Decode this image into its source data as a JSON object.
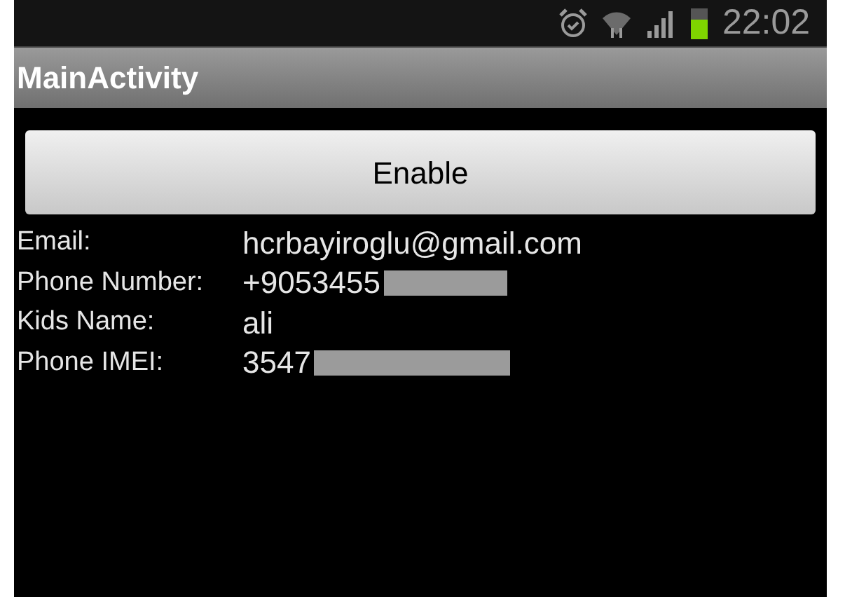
{
  "status_bar": {
    "time": "22:02"
  },
  "title_bar": {
    "title": "MainActivity"
  },
  "button": {
    "label": "Enable"
  },
  "fields": [
    {
      "label": "Email:",
      "value": "hcrbayiroglu@gmail.com",
      "redacted": false
    },
    {
      "label": "Phone Number:",
      "value": "+9053455",
      "redacted": true
    },
    {
      "label": "Kids Name:",
      "value": "ali",
      "redacted": false
    },
    {
      "label": "Phone IMEI:",
      "value": "3547",
      "redacted": true
    }
  ]
}
